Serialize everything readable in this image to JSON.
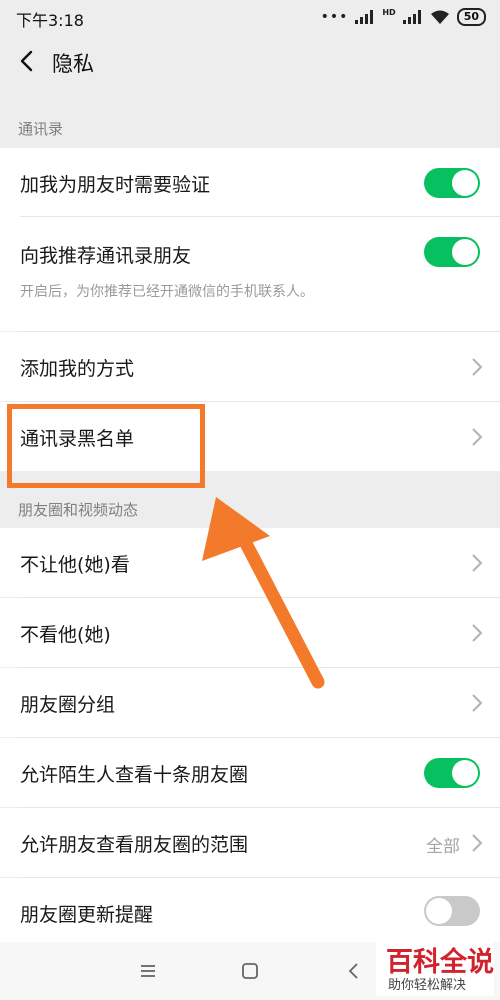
{
  "status": {
    "time": "下午3:18",
    "dots": "•••",
    "hd": "HD",
    "battery": "50"
  },
  "navbar": {
    "title": "隐私"
  },
  "sections": {
    "contacts": "通讯录",
    "moments": "朋友圈和视频动态"
  },
  "rows": {
    "verify_friend": {
      "label": "加我为朋友时需要验证",
      "toggle": "on"
    },
    "recommend_contacts": {
      "label": "向我推荐通讯录朋友",
      "sub": "开启后，为你推荐已经开通微信的手机联系人。",
      "toggle": "on"
    },
    "add_me_ways": {
      "label": "添加我的方式"
    },
    "contacts_blacklist": {
      "label": "通讯录黑名单"
    },
    "hide_from": {
      "label": "不让他(她)看"
    },
    "dont_see": {
      "label": "不看他(她)"
    },
    "moments_groups": {
      "label": "朋友圈分组"
    },
    "stranger_ten": {
      "label": "允许陌生人查看十条朋友圈",
      "toggle": "on"
    },
    "moments_range": {
      "label": "允许朋友查看朋友圈的范围",
      "value": "全部"
    },
    "moments_update": {
      "label": "朋友圈更新提醒",
      "toggle": "off"
    }
  },
  "watermark": {
    "title": "百科全说",
    "subtitle": "助你轻松解决"
  },
  "colors": {
    "accent_green": "#07c160",
    "highlight_orange": "#f27a2a",
    "watermark_red": "#d1232c"
  }
}
